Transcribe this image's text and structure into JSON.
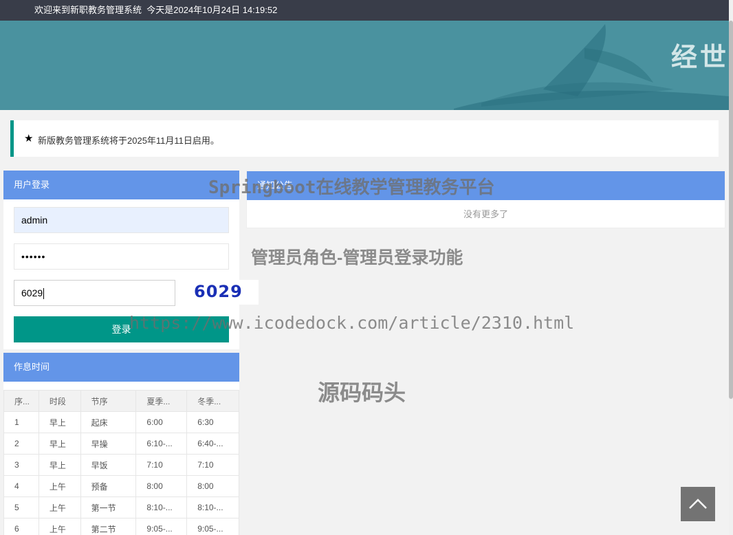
{
  "topbar": {
    "welcome": "欢迎来到新职教务管理系统",
    "date_text": "今天是2024年10月24日 14:19:52"
  },
  "banner": {
    "calligraphy": "经世"
  },
  "notice": {
    "icon": "star-icon",
    "text": "新版教务管理系统将于2025年11月11日启用。"
  },
  "login": {
    "title": "用户登录",
    "username": "admin",
    "password_mask": "••••••",
    "captcha_value": "6029",
    "captcha_image_text": "6029",
    "submit_label": "登录"
  },
  "news": {
    "title": "通知公告",
    "empty_text": "没有更多了"
  },
  "schedule": {
    "title": "作息时间",
    "columns": [
      "序...",
      "时段",
      "节序",
      "夏季...",
      "冬季..."
    ],
    "rows": [
      [
        "1",
        "早上",
        "起床",
        "6:00",
        "6:30"
      ],
      [
        "2",
        "早上",
        "早操",
        "6:10-...",
        "6:40-..."
      ],
      [
        "3",
        "早上",
        "早饭",
        "7:10",
        "7:10"
      ],
      [
        "4",
        "上午",
        "预备",
        "8:00",
        "8:00"
      ],
      [
        "5",
        "上午",
        "第一节",
        "8:10-...",
        "8:10-..."
      ],
      [
        "6",
        "上午",
        "第二节",
        "9:05-...",
        "9:05-..."
      ]
    ]
  },
  "watermarks": {
    "line1": "Springboot在线教学管理教务平台",
    "line2": "管理员角色-管理员登录功能",
    "line3": "https://www.icodedock.com/article/2310.html",
    "line4": "源码码头"
  },
  "colors": {
    "topbar": "#393D49",
    "banner": "#4a929f",
    "panel_header": "#6395e8",
    "accent": "#009688"
  },
  "back_to_top": {
    "icon": "chevron-up-icon"
  }
}
